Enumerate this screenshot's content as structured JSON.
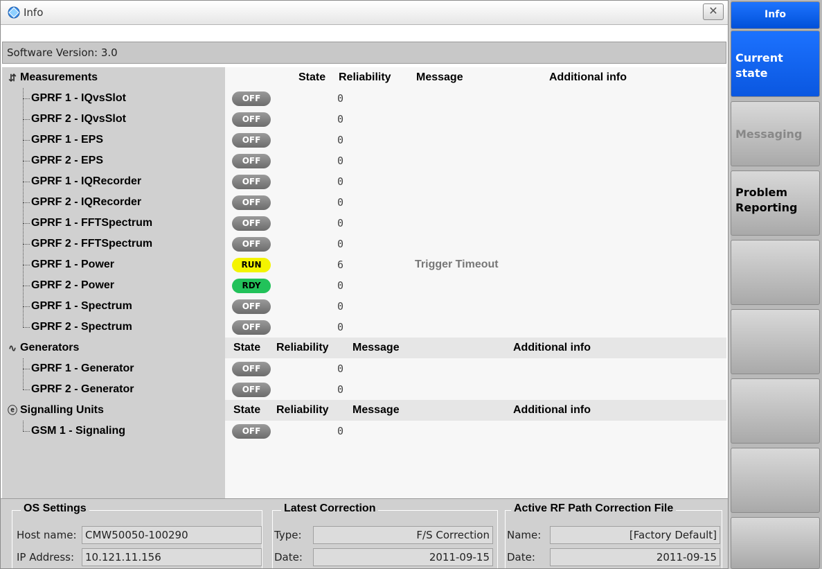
{
  "window": {
    "title": "Info",
    "close_glyph": "✕"
  },
  "software_version": "Software Version:  3.0",
  "groups": [
    {
      "name": "Measurements",
      "icon": "measurements-icon",
      "headers": {
        "state": "State",
        "reliability": "Reliability",
        "message": "Message",
        "additional": "Additional info"
      },
      "items": [
        {
          "label": "GPRF 1 - IQvsSlot",
          "state": "OFF",
          "reliability": "0",
          "message": ""
        },
        {
          "label": "GPRF 2 - IQvsSlot",
          "state": "OFF",
          "reliability": "0",
          "message": ""
        },
        {
          "label": "GPRF 1 - EPS",
          "state": "OFF",
          "reliability": "0",
          "message": ""
        },
        {
          "label": "GPRF 2 - EPS",
          "state": "OFF",
          "reliability": "0",
          "message": ""
        },
        {
          "label": "GPRF 1 - IQRecorder",
          "state": "OFF",
          "reliability": "0",
          "message": ""
        },
        {
          "label": "GPRF 2 - IQRecorder",
          "state": "OFF",
          "reliability": "0",
          "message": ""
        },
        {
          "label": "GPRF 1 - FFTSpectrum",
          "state": "OFF",
          "reliability": "0",
          "message": ""
        },
        {
          "label": "GPRF 2 - FFTSpectrum",
          "state": "OFF",
          "reliability": "0",
          "message": ""
        },
        {
          "label": "GPRF 1 - Power",
          "state": "RUN",
          "reliability": "6",
          "message": "Trigger Timeout"
        },
        {
          "label": "GPRF 2 - Power",
          "state": "RDY",
          "reliability": "0",
          "message": ""
        },
        {
          "label": "GPRF 1 - Spectrum",
          "state": "OFF",
          "reliability": "0",
          "message": ""
        },
        {
          "label": "GPRF 2 - Spectrum",
          "state": "OFF",
          "reliability": "0",
          "message": ""
        }
      ]
    },
    {
      "name": "Generators",
      "icon": "generators-icon",
      "headers": {
        "state": "State",
        "reliability": "Reliability",
        "message": "Message",
        "additional": "Additional info"
      },
      "items": [
        {
          "label": "GPRF 1 - Generator",
          "state": "OFF",
          "reliability": "0",
          "message": ""
        },
        {
          "label": "GPRF 2 - Generator",
          "state": "OFF",
          "reliability": "0",
          "message": ""
        }
      ]
    },
    {
      "name": "Signalling Units",
      "icon": "signalling-units-icon",
      "headers": {
        "state": "State",
        "reliability": "Reliability",
        "message": "Message",
        "additional": "Additional info"
      },
      "items": [
        {
          "label": "GSM 1 - Signaling",
          "state": "OFF",
          "reliability": "0",
          "message": ""
        }
      ]
    }
  ],
  "os_settings": {
    "title": "OS Settings",
    "host_label": "Host name:",
    "host_value": "CMW50050-100290",
    "ip_label": "IP Address:",
    "ip_value": "10.121.11.156"
  },
  "latest_correction": {
    "title": "Latest Correction",
    "type_label": "Type:",
    "type_value": "F/S Correction",
    "date_label": "Date:",
    "date_value": "2011-09-15"
  },
  "active_rf": {
    "title": "Active RF Path Correction File",
    "name_label": "Name:",
    "name_value": "[Factory Default]",
    "date_label": "Date:",
    "date_value": "2011-09-15"
  },
  "softkeys": {
    "title": "Info",
    "current_state": "Current\nstate",
    "messaging": "Messaging",
    "problem_reporting": "Problem\nReporting"
  },
  "colors": {
    "state_off": "#7a7a7a",
    "state_run": "#f4f400",
    "state_rdy": "#22c25a",
    "accent": "#0a57e0"
  }
}
